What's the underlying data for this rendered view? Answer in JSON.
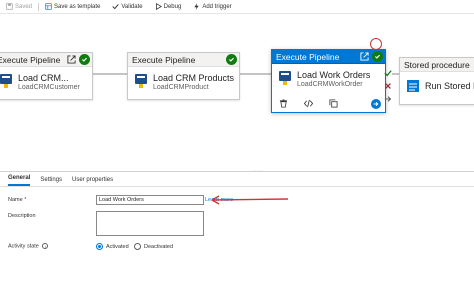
{
  "toolbar": {
    "saved_label": "Saved",
    "save_template_label": "Save as template",
    "validate_label": "Validate",
    "debug_label": "Debug",
    "add_trigger_label": "Add trigger"
  },
  "activities": [
    {
      "type_label": "Execute Pipeline",
      "title": "Load CRM...",
      "subtitle": "LoadCRMCustomer",
      "icon": "pipeline-icon",
      "status": "succeeded"
    },
    {
      "type_label": "Execute Pipeline",
      "title": "Load CRM Products",
      "subtitle": "LoadCRMProduct",
      "icon": "pipeline-icon",
      "status": "succeeded"
    },
    {
      "type_label": "Execute Pipeline",
      "title": "Load Work Orders",
      "subtitle": "LoadCRMWorkOrder",
      "icon": "pipeline-icon",
      "status": "succeeded",
      "selected": true
    },
    {
      "type_label": "Stored procedure",
      "title": "Run Stored P",
      "icon": "stored-procedure-icon"
    }
  ],
  "node_action_icons": [
    "delete-icon",
    "code-icon",
    "copy-icon",
    "run-arrow-icon"
  ],
  "side_badge_icons": [
    "checkmark-icon",
    "close-icon",
    "arrow-icon"
  ],
  "properties": {
    "tabs": [
      "General",
      "Settings",
      "User properties"
    ],
    "active_tab": "General",
    "name_label": "Name",
    "name_required_mark": "*",
    "name_value": "Load Work Orders",
    "learn_more_label": "Learn more",
    "description_label": "Description",
    "description_value": "",
    "activity_state_label": "Activity state",
    "activity_state_options": [
      "Activated",
      "Deactivated"
    ],
    "activity_state_selected": "Activated"
  },
  "colors": {
    "accent": "#0078d4",
    "success": "#107c10",
    "annotation": "#d13438"
  }
}
